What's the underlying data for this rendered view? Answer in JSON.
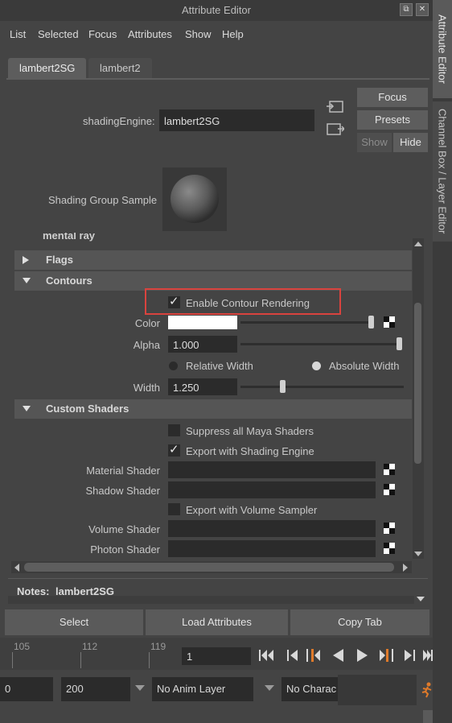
{
  "window": {
    "title": "Attribute Editor"
  },
  "side_tabs": [
    "Attribute Editor",
    "Channel Box / Layer Editor"
  ],
  "menu": [
    "List",
    "Selected",
    "Focus",
    "Attributes",
    "Show",
    "Help"
  ],
  "node_tabs": [
    "lambert2SG",
    "lambert2"
  ],
  "header": {
    "shading_engine_label": "shadingEngine:",
    "shading_engine_value": "lambert2SG",
    "focus_label": "Focus",
    "presets_label": "Presets",
    "show_label": "Show",
    "hide_label": "Hide",
    "sample_label": "Shading Group Sample"
  },
  "sections": {
    "mental_ray": "mental ray",
    "flags": "Flags",
    "contours": "Contours",
    "custom_shaders": "Custom Shaders"
  },
  "contours": {
    "enable_label": "Enable Contour Rendering",
    "enable_checked": true,
    "color_label": "Color",
    "color_value": "#ffffff",
    "alpha_label": "Alpha",
    "alpha_value": "1.000",
    "relative_width_label": "Relative Width",
    "absolute_width_label": "Absolute Width",
    "selected_width_mode": "Absolute Width",
    "width_label": "Width",
    "width_value": "1.250"
  },
  "custom_shaders": {
    "suppress_label": "Suppress all Maya Shaders",
    "suppress_checked": false,
    "export_shading_label": "Export with Shading Engine",
    "export_shading_checked": true,
    "material_shader_label": "Material Shader",
    "shadow_shader_label": "Shadow Shader",
    "export_volume_label": "Export with Volume Sampler",
    "export_volume_checked": false,
    "volume_shader_label": "Volume Shader",
    "photon_shader_label": "Photon Shader"
  },
  "notes": {
    "label": "Notes:",
    "value": "lambert2SG"
  },
  "bottom_buttons": {
    "select": "Select",
    "load": "Load Attributes",
    "copy": "Copy Tab"
  },
  "timeline": {
    "ticks": [
      "105",
      "112",
      "119"
    ],
    "current_frame": "1"
  },
  "range": {
    "start": "0",
    "end": "200",
    "anim_layer": "No Anim Layer",
    "character": "No Charac"
  },
  "colors": {
    "highlight_box": "#d9433e",
    "playhead": "#e07a2a"
  }
}
